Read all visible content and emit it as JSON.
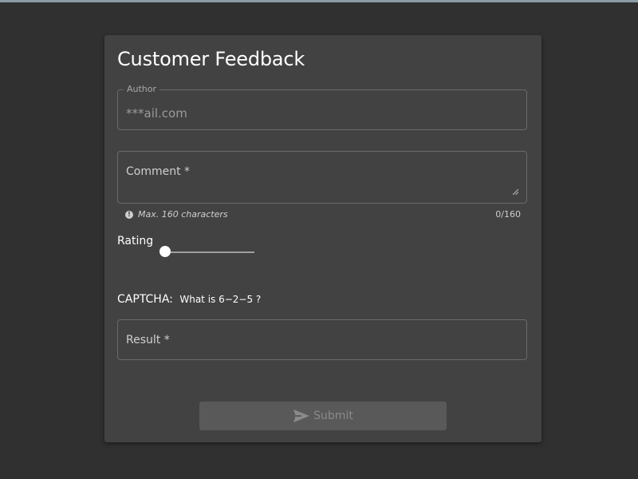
{
  "form": {
    "title": "Customer Feedback",
    "author": {
      "label": "Author",
      "value": "***ail.com"
    },
    "comment": {
      "label": "Comment *",
      "hint": "Max. 160 characters",
      "counter": "0/160"
    },
    "rating": {
      "label": "Rating",
      "value_fraction": 0.0
    },
    "captcha": {
      "label": "CAPTCHA:",
      "question": "What is  6−2−5 ?"
    },
    "result": {
      "label": "Result *"
    },
    "submit": {
      "label": "Submit",
      "icon": "send-icon"
    }
  },
  "colors": {
    "background": "#303030",
    "card": "#424242",
    "topbar": "#8a9ba3",
    "button_disabled": "#595959"
  }
}
